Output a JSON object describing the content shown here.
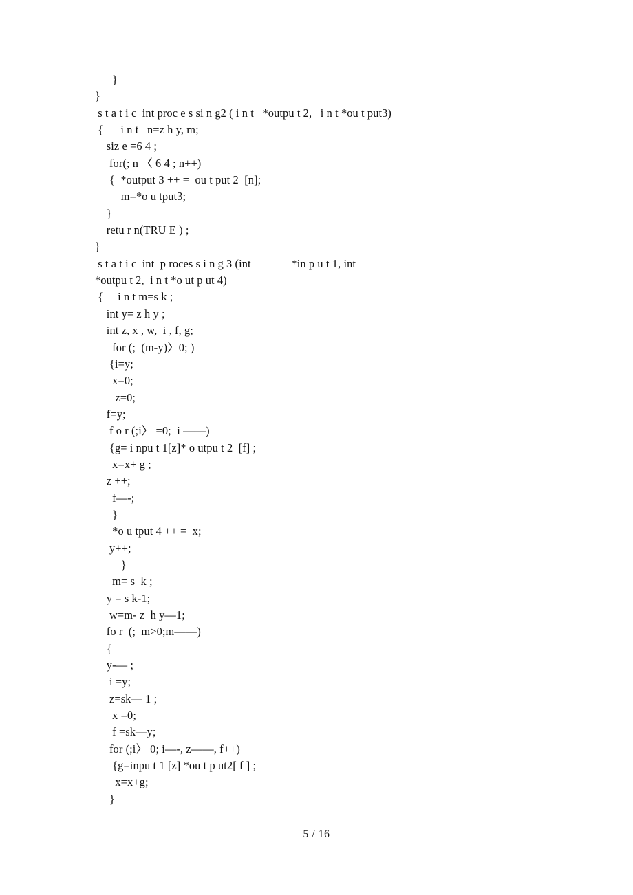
{
  "document": {
    "page_label": "5 / 16",
    "body_lines": [
      {
        "text": "      }",
        "faint": false
      },
      {
        "text": "}",
        "faint": false
      },
      {
        "text": " s t a t i c  int proc e s si n g2 ( i n t   *outpu t 2,   i n t *ou t put3)",
        "faint": false
      },
      {
        "text": " {      i n t   n=z h y, m;",
        "faint": false
      },
      {
        "text": "    siz e =6 4 ;",
        "faint": false
      },
      {
        "text": "     for(; n 〈 6 4 ; n++)",
        "faint": false
      },
      {
        "text": "     {  *output 3 ++ =  ou t put 2  [n];",
        "faint": false
      },
      {
        "text": "         m=*o u tput3;",
        "faint": false
      },
      {
        "text": "    }",
        "faint": false
      },
      {
        "text": "    retu r n(TRU E ) ;",
        "faint": false
      },
      {
        "text": "}",
        "faint": false
      },
      {
        "text": " s t a t i c  int  p roces s i n g 3 (int              *in p u t 1, int",
        "faint": false
      },
      {
        "text": "*outpu t 2,  i n t *o ut p ut 4)",
        "faint": false
      },
      {
        "text": " {     i n t m=s k ;",
        "faint": false
      },
      {
        "text": "    int y= z h y ;",
        "faint": false
      },
      {
        "text": "    int z, x , w,  i , f, g;",
        "faint": false
      },
      {
        "text": "      for (;  (m-y)〉0; )",
        "faint": false
      },
      {
        "text": "     {i=y;",
        "faint": false
      },
      {
        "text": "      x=0;",
        "faint": false
      },
      {
        "text": "       z=0;",
        "faint": false
      },
      {
        "text": "    f=y;",
        "faint": false
      },
      {
        "text": "     f o r (;i〉 =0;  i ——)",
        "faint": false
      },
      {
        "text": "     {g= i npu t 1[z]* o utpu t 2  [f] ;",
        "faint": false
      },
      {
        "text": "      x=x+ g ;",
        "faint": false
      },
      {
        "text": "    z ++;",
        "faint": false
      },
      {
        "text": "      f—-;",
        "faint": false
      },
      {
        "text": "      }",
        "faint": false
      },
      {
        "text": "      *o u tput 4 ++ =  x;",
        "faint": false
      },
      {
        "text": "     y++;",
        "faint": false
      },
      {
        "text": "         }",
        "faint": false
      },
      {
        "text": "      m= s  k ;",
        "faint": false
      },
      {
        "text": "    y = s k-1;",
        "faint": false
      },
      {
        "text": "     w=m- z  h y—1;",
        "faint": false
      },
      {
        "text": "    fo r  (;  m>0;m——)",
        "faint": false
      },
      {
        "text": "    {",
        "faint": true
      },
      {
        "text": "    y-— ;",
        "faint": false
      },
      {
        "text": "     i =y;",
        "faint": false
      },
      {
        "text": "     z=sk— 1 ;",
        "faint": false
      },
      {
        "text": "      x =0;",
        "faint": false
      },
      {
        "text": "      f =sk—y;",
        "faint": false
      },
      {
        "text": "     for (;i〉 0; i—-, z——, f++)",
        "faint": false
      },
      {
        "text": "      {g=inpu t 1 [z] *ou t p ut2[ f ] ;",
        "faint": false
      },
      {
        "text": "       x=x+g;",
        "faint": false
      },
      {
        "text": "     }",
        "faint": false
      }
    ]
  }
}
